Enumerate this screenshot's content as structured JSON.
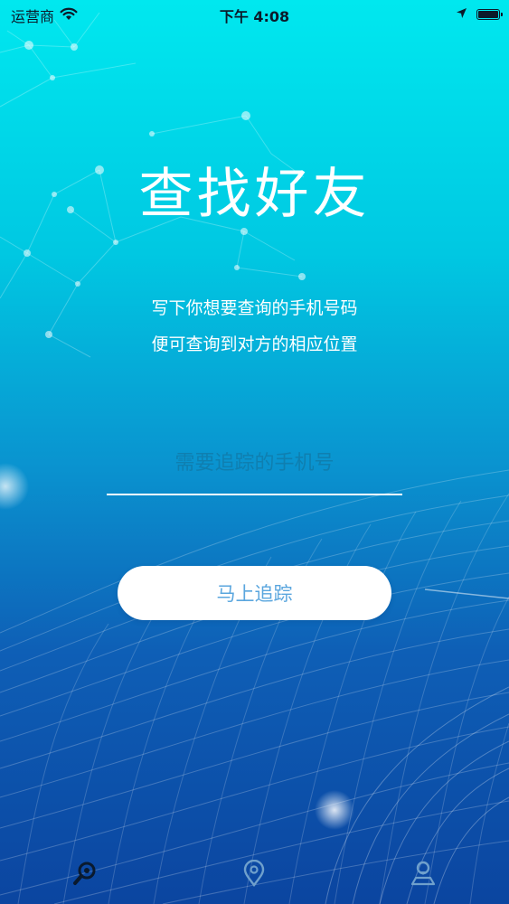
{
  "status_bar": {
    "carrier": "运营商",
    "time": "下午 4:08",
    "battery_level": 1.0,
    "icons": [
      "wifi-icon",
      "location-arrow-icon",
      "battery-icon"
    ]
  },
  "main": {
    "title": "查找好友",
    "subtitle_line1": "写下你想要查询的手机号码",
    "subtitle_line2": "便可查询到对方的相应位置",
    "phone_input": {
      "value": "",
      "placeholder": "需要追踪的手机号"
    },
    "track_button_label": "马上追踪"
  },
  "tab_bar": {
    "items": [
      {
        "icon": "search-icon",
        "selected": true
      },
      {
        "icon": "location-pin-icon",
        "selected": false
      },
      {
        "icon": "user-pin-icon",
        "selected": false
      }
    ]
  },
  "colors": {
    "gradient_top": "#00e8ef",
    "gradient_bottom": "#0b45a0",
    "button_bg": "#ffffff",
    "button_text": "#5aa6de",
    "tab_selected": "#0a1a2e",
    "tab_unselected": "#6fa0cc"
  }
}
